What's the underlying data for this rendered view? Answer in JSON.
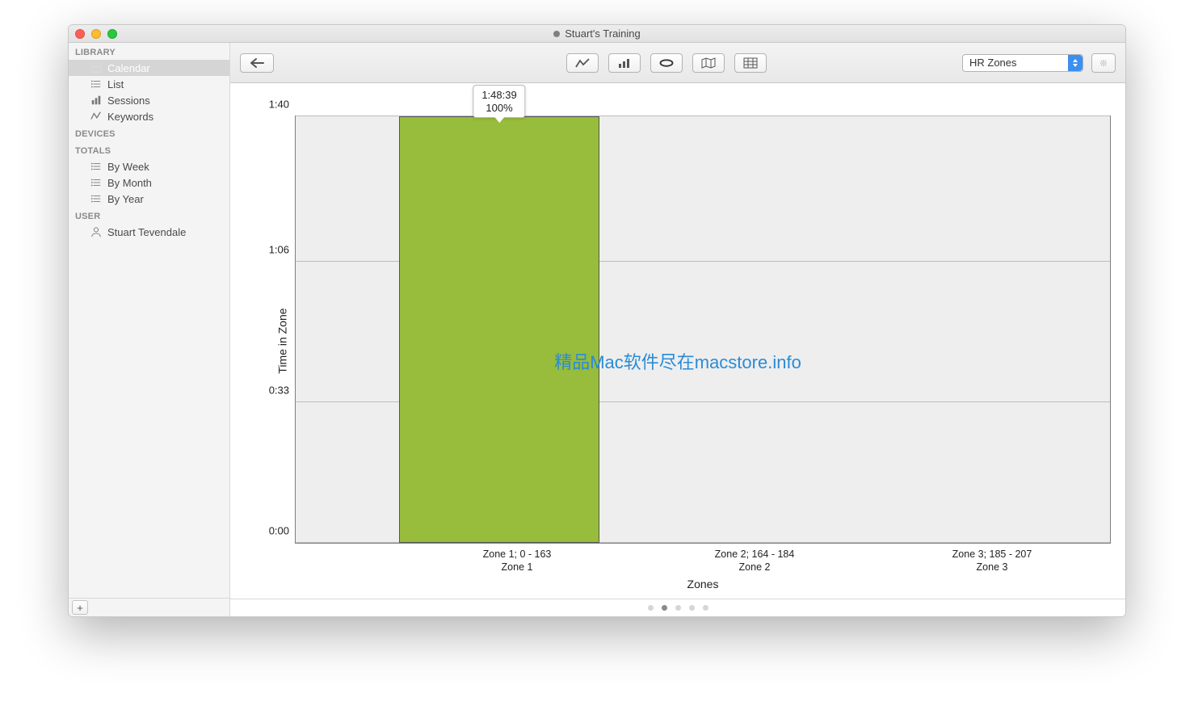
{
  "window": {
    "title": "Stuart's Training"
  },
  "sidebar": {
    "sections": {
      "library": {
        "header": "LIBRARY",
        "items": [
          {
            "label": "Calendar",
            "icon": "calendar-icon",
            "selected": true
          },
          {
            "label": "List",
            "icon": "list-icon"
          },
          {
            "label": "Sessions",
            "icon": "sessions-icon"
          },
          {
            "label": "Keywords",
            "icon": "keywords-icon"
          }
        ]
      },
      "devices": {
        "header": "DEVICES"
      },
      "totals": {
        "header": "TOTALS",
        "items": [
          {
            "label": "By Week",
            "icon": "list-icon"
          },
          {
            "label": "By Month",
            "icon": "list-icon"
          },
          {
            "label": "By Year",
            "icon": "list-icon"
          }
        ]
      },
      "user": {
        "header": "USER",
        "items": [
          {
            "label": "Stuart Tevendale",
            "icon": "user-icon"
          }
        ]
      }
    }
  },
  "toolbar": {
    "dropdown": {
      "selected": "HR Zones"
    }
  },
  "chart_data": {
    "type": "bar",
    "title": "",
    "xlabel": "Zones",
    "ylabel": "Time in Zone",
    "y_ticks_minutes": [
      0,
      33,
      66,
      100
    ],
    "y_tick_labels": [
      "0:00",
      "0:33",
      "1:06",
      "1:40"
    ],
    "categories": [
      {
        "line1": "Zone 1; 0 - 163",
        "line2": "Zone 1"
      },
      {
        "line1": "Zone 2; 164 - 184",
        "line2": "Zone 2"
      },
      {
        "line1": "Zone 3; 185 - 207",
        "line2": "Zone 3"
      }
    ],
    "values_minutes": [
      108.65,
      0,
      0
    ],
    "tooltip": {
      "line1": "1:48:39",
      "line2": "100%"
    },
    "bar_color": "#98bc3c"
  },
  "watermark": "精品Mac软件尽在macstore.info",
  "pager": {
    "count": 5,
    "active_index": 1
  }
}
